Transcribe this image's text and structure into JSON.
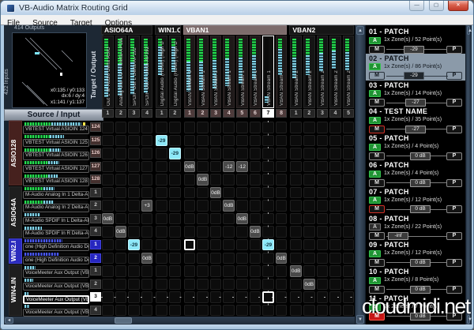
{
  "window": {
    "title": "VB-Audio Matrix Routing Grid",
    "menu": [
      "File",
      "Source",
      "Target",
      "Options"
    ]
  },
  "icons": {
    "minimize": "—",
    "maximize": "▢",
    "close": "✕",
    "up": "▲",
    "down": "▼",
    "left": "◄"
  },
  "overview": {
    "outputs_label": "414 Outputs",
    "inputs_label": "422 Inputs",
    "target_label": "Target / Output",
    "source_label": "Source / Input",
    "coords": [
      "x0:135 / y0:133",
      "dx:6 / dy:4",
      "x1:141 / y1:137"
    ]
  },
  "matrix": {
    "column_groups": [
      {
        "name": "ASIO64A",
        "cols": [
          {
            "num": "1",
            "label": "Out 1 M-Audio Delta ASIO",
            "meter": {
              "g": 0.4,
              "c": 0.88
            }
          },
          {
            "num": "2",
            "label": "Analog Out 1/2 R Delta-AP192",
            "meter": {
              "g": 0.38,
              "c": 0.86
            }
          },
          {
            "num": "3",
            "label": "SPDIF Out L Delta-AP192",
            "meter": {
              "g": 0.36,
              "c": 0.84
            }
          },
          {
            "num": "4",
            "label": "SPDIF Out R Delta-AP192",
            "meter": {
              "g": 0.38,
              "c": 0.82
            }
          }
        ]
      },
      {
        "name": "WIN1.O",
        "cols": [
          {
            "num": "1",
            "label": "Digital Audio (HDMI) (High D",
            "meter": {
              "g": 0.12,
              "c": 0.55
            }
          },
          {
            "num": "2",
            "label": "Digital Audio (HDMI) (High D",
            "meter": {
              "g": 0.12,
              "c": 0.5
            }
          }
        ]
      },
      {
        "name": "VBAN1",
        "accent": "mauve",
        "cols": [
          {
            "num": "1",
            "label": "VBAN Stream 1",
            "meter": {
              "g": 0.35,
              "c": 0.8
            }
          },
          {
            "num": "2",
            "label": "VBAN Stream 1",
            "meter": {
              "g": 0.34,
              "c": 0.78
            }
          },
          {
            "num": "3",
            "label": "VBAN Stream 1",
            "meter": {
              "g": 0.32,
              "c": 0.75
            }
          },
          {
            "num": "4",
            "label": "VBAN Stream 1",
            "meter": {
              "g": 0.3,
              "c": 0.72
            }
          },
          {
            "num": "5",
            "label": "VBAN Stream 1",
            "meter": {
              "g": 0.28,
              "c": 0.68
            }
          },
          {
            "num": "6",
            "label": "VBAN Stream 1",
            "meter": {
              "g": 0.25,
              "c": 0.62
            }
          },
          {
            "num": "7",
            "label": "VBAN Stream 1",
            "selected": true,
            "meter": {
              "g": 0,
              "c": 0.1,
              "bottom": true
            }
          },
          {
            "num": "8",
            "label": "VBAN Stream 1",
            "meter": {
              "g": 0.15,
              "c": 0.55
            }
          }
        ]
      },
      {
        "name": "VBAN2",
        "cols": [
          {
            "num": "1",
            "label": "VBAN Stream 2",
            "meter": {
              "g": 0.28,
              "c": 0.6
            }
          },
          {
            "num": "2",
            "label": "VBAN Stream 2",
            "meter": {
              "g": 0.25,
              "c": 0.55
            }
          },
          {
            "num": "3",
            "label": "VBAN Stream 2",
            "meter": {
              "g": 0.22,
              "c": 0.5
            }
          },
          {
            "num": "4",
            "label": "VBAN Stream 2",
            "meter": {
              "g": 0.18,
              "c": 0.45
            }
          },
          {
            "num": "5",
            "label": "VBAN Stream 2",
            "meter": {
              "g": 0.2,
              "c": 0.48
            }
          }
        ]
      }
    ],
    "row_groups": [
      {
        "name": "ASIO128",
        "accent": "maroon",
        "rows": [
          {
            "num": "124",
            "label": "VBTEST Virtual ASIO",
            "right": "IN 124",
            "meter": {
              "g": 0.42,
              "c": 0.9,
              "tip": true
            }
          },
          {
            "num": "125",
            "label": "VBTEST Virtual ASIO",
            "right": "IN 125",
            "meter": {
              "g": 0.4,
              "c": 0.62
            }
          },
          {
            "num": "126",
            "label": "VBTEST Virtual ASIO",
            "right": "IN 126",
            "meter": {
              "g": 0.4,
              "c": 0.58
            }
          },
          {
            "num": "127",
            "label": "VBTEST Virtual ASIO",
            "right": "IN 127",
            "meter": {
              "g": 0.38,
              "c": 0.55
            }
          },
          {
            "num": "128",
            "label": "VBTEST Virtual ASIO",
            "right": "IN 128",
            "meter": {
              "g": 0.38,
              "c": 0.52
            }
          }
        ]
      },
      {
        "name": "ASIO64A",
        "accent": "dark",
        "rows": [
          {
            "num": "1",
            "label": "M-Audio  Analog In 1 Delta-AP192",
            "right": "",
            "meter": {
              "g": 0.3,
              "c": 0.48
            }
          },
          {
            "num": "2",
            "label": "M-Audio  Analog In 2 Delta-AP192",
            "right": "",
            "meter": {
              "g": 0.3,
              "c": 0.46
            }
          },
          {
            "num": "3",
            "label": "M-Audio  SPDIF In L Delta-AP192",
            "right": "",
            "meter": {
              "g": 0,
              "c": 0.25
            }
          },
          {
            "num": "4",
            "label": "M-Audio  SPDIF In R Delta-AP192",
            "right": "",
            "meter": {
              "g": 0,
              "c": 0.28
            }
          }
        ]
      },
      {
        "name": "WIN2.I",
        "accent": "blue",
        "rows": [
          {
            "num": "1",
            "label": "one (High Definition Audio Device)",
            "right": "",
            "blue": true,
            "meter": {
              "g": 0,
              "c": 0.6
            }
          },
          {
            "num": "2",
            "label": "one (High Definition Audio Device)",
            "right": "",
            "blue": true,
            "meter": {
              "g": 0,
              "c": 0.55
            }
          }
        ]
      },
      {
        "name": "WIN4.IN",
        "accent": "dark",
        "rows": [
          {
            "num": "1",
            "label": "VoiceMeeter Aux Output (VB-Audi",
            "right": "",
            "meter": {
              "g": 0,
              "c": 0.18
            }
          },
          {
            "num": "2",
            "label": "VoiceMeeter Aux Output (VB-Audi",
            "right": "",
            "meter": {
              "g": 0,
              "c": 0.14
            }
          },
          {
            "num": "3",
            "label": "VoiceMeeter Aux Output (VB-Audi",
            "right": "",
            "selected": true,
            "meter": {
              "g": 0,
              "c": 0.06
            }
          },
          {
            "num": "4",
            "label": "VoiceMeeter Aux Output (VB-Audi",
            "right": "",
            "meter": {
              "g": 0,
              "c": 0.08
            }
          }
        ]
      }
    ],
    "cells": [
      {
        "r": 1,
        "c": 4,
        "v": "-29",
        "t": "cyan"
      },
      {
        "r": 2,
        "c": 5,
        "v": "-29",
        "t": "cyan"
      },
      {
        "r": 3,
        "c": 6,
        "v": "0dB",
        "t": "db"
      },
      {
        "r": 3,
        "c": 9,
        "v": "-12",
        "t": "db"
      },
      {
        "r": 3,
        "c": 10,
        "v": "-12",
        "t": "db"
      },
      {
        "r": 4,
        "c": 7,
        "v": "0dB",
        "t": "db"
      },
      {
        "r": 5,
        "c": 8,
        "v": "0dB",
        "t": "db"
      },
      {
        "r": 6,
        "c": 3,
        "v": "+3",
        "t": "db"
      },
      {
        "r": 6,
        "c": 9,
        "v": "0dB",
        "t": "db"
      },
      {
        "r": 7,
        "c": 0,
        "v": "0dB",
        "t": "db"
      },
      {
        "r": 7,
        "c": 10,
        "v": "0dB",
        "t": "db"
      },
      {
        "r": 8,
        "c": 1,
        "v": "0dB",
        "t": "db"
      },
      {
        "r": 8,
        "c": 11,
        "v": "0dB",
        "t": "db"
      },
      {
        "r": 9,
        "c": 2,
        "v": "-29",
        "t": "cyan"
      },
      {
        "r": 9,
        "c": 6,
        "v": "",
        "t": "sel"
      },
      {
        "r": 9,
        "c": 12,
        "v": "-29",
        "t": "cyan"
      },
      {
        "r": 10,
        "c": 3,
        "v": "0dB",
        "t": "db"
      },
      {
        "r": 10,
        "c": 13,
        "v": "0dB",
        "t": "db"
      },
      {
        "r": 11,
        "c": 14,
        "v": "0dB",
        "t": "db"
      },
      {
        "r": 12,
        "c": 15,
        "v": "0dB",
        "t": "db"
      },
      {
        "r": 13,
        "c": 12,
        "v": "",
        "t": "sel"
      }
    ],
    "selected": {
      "row": 13,
      "col": 12
    }
  },
  "patch_ui": {
    "armed": "A",
    "mute": "M",
    "preset": "P"
  },
  "patches": [
    {
      "title": "01 - PATCH",
      "info": "1x Zone(s) / 52 Point(s)",
      "a": "on",
      "m": "normal",
      "val": "-29",
      "pos": 0.42
    },
    {
      "title": "02 - PATCH",
      "info": "1x Zone(s) / 86 Point(s)",
      "a": "on",
      "m": "normal",
      "val": "-29",
      "pos": 0.42,
      "selected": true
    },
    {
      "title": "03 - PATCH",
      "info": "1x Zone(s) / 14 Point(s)",
      "a": "on",
      "m": "normal",
      "val": "-27",
      "pos": 0.45
    },
    {
      "title": "04 - TEST NAME",
      "info": "1x Zone(s) / 35 Point(s)",
      "a": "on",
      "m": "redline",
      "val": "-27",
      "pos": 0.45
    },
    {
      "title": "05 - PATCH",
      "info": "1x Zone(s) / 4 Point(s)",
      "a": "on",
      "m": "normal",
      "val": "0 dB",
      "pos": 0.58
    },
    {
      "title": "06 - PATCH",
      "info": "1x Zone(s) / 4 Point(s)",
      "a": "on",
      "m": "normal",
      "val": "0 dB",
      "pos": 0.58
    },
    {
      "title": "07 - PATCH",
      "info": "1x Zone(s) / 12 Point(s)",
      "a": "on",
      "m": "redline",
      "val": "0 dB",
      "pos": 0.58
    },
    {
      "title": "08 - PATCH",
      "info": "1x Zone(s) / 22 Point(s)",
      "a": "off",
      "m": "normal",
      "val": "-inf",
      "pos": 0.02
    },
    {
      "title": "09 - PATCH",
      "info": "1x Zone(s) / 12 Point(s)",
      "a": "on",
      "m": "normal",
      "val": "0 dB",
      "pos": 0.58
    },
    {
      "title": "10 - PATCH",
      "info": "1x Zone(s) / 8 Point(s)",
      "a": "on",
      "m": "normal",
      "val": "0 dB",
      "pos": 0.58
    },
    {
      "title": "11 - PATCH",
      "info": "2x Zone(s) / 7 Point(s)",
      "a": "on",
      "m": "redfill",
      "val": "0 dB",
      "pos": 0.58
    }
  ],
  "watermark": "cloudmidi.net"
}
